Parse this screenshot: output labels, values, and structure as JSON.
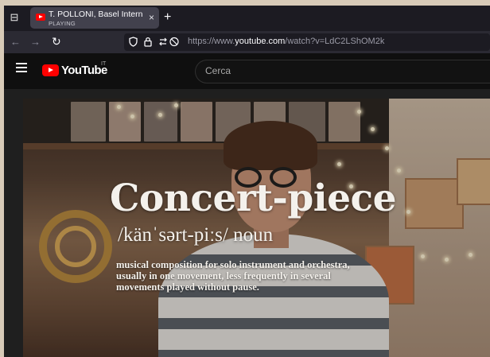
{
  "browser": {
    "tab": {
      "title": "T. POLLONI, Basel Intern",
      "status": "PLAYING",
      "close_symbol": "×"
    },
    "new_tab_symbol": "+",
    "nav": {
      "back_symbol": "←",
      "forward_symbol": "→",
      "reload_symbol": "↻"
    },
    "url": {
      "prefix": "https://www.",
      "domain": "youtube.com",
      "path": "/watch?v=LdC2LShOM2k"
    }
  },
  "youtube": {
    "logo_text": "YouTube",
    "country_code": "IT",
    "search_placeholder": "Cerca"
  },
  "video": {
    "overlay_title": "Concert-piece",
    "overlay_phonetic": "/känˈsərt-piːs/  noun",
    "overlay_definition": "musical composition for solo instrument and orchestra, usually in one movement, less frequently in several movements played without pause."
  },
  "colors": {
    "youtube_red": "#ff0000",
    "browser_chrome": "#1c1b22",
    "tab_active": "#42414d",
    "yt_background": "#0f0f0f"
  }
}
